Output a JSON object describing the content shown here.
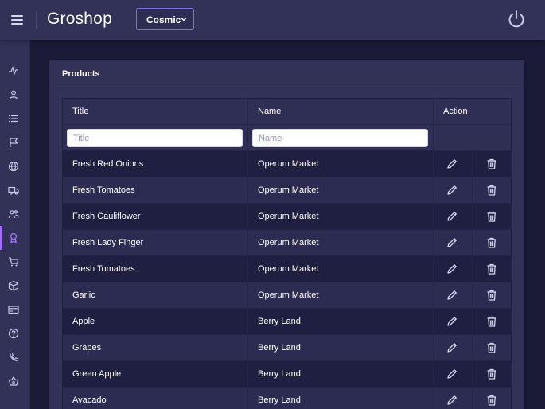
{
  "header": {
    "brand": "Groshop",
    "theme": "Cosmic",
    "menu_icon": "hamburger-icon",
    "power_icon": "power-icon"
  },
  "sidebar": {
    "items": [
      {
        "icon": "activity-icon"
      },
      {
        "icon": "user-icon"
      },
      {
        "icon": "list-icon"
      },
      {
        "icon": "flag-icon"
      },
      {
        "icon": "globe-icon"
      },
      {
        "icon": "truck-icon"
      },
      {
        "icon": "people-icon"
      },
      {
        "icon": "award-icon",
        "active": true
      },
      {
        "icon": "cart-icon"
      },
      {
        "icon": "cube-icon"
      },
      {
        "icon": "credit-card-icon"
      },
      {
        "icon": "question-icon"
      },
      {
        "icon": "phone-icon"
      },
      {
        "icon": "basket-icon"
      }
    ]
  },
  "products": {
    "card_title": "Products",
    "columns": {
      "title": "Title",
      "name": "Name",
      "action": "Action"
    },
    "filters": {
      "title_placeholder": "Title",
      "name_placeholder": "Name"
    },
    "rows": [
      {
        "title": "Fresh Red Onions",
        "name": "Operum Market"
      },
      {
        "title": "Fresh Tomatoes",
        "name": "Operum Market"
      },
      {
        "title": "Fresh Cauliflower",
        "name": "Operum Market"
      },
      {
        "title": "Fresh Lady Finger",
        "name": "Operum Market"
      },
      {
        "title": "Fresh Tomatoes",
        "name": "Operum Market"
      },
      {
        "title": "Garlic",
        "name": "Operum Market"
      },
      {
        "title": "Apple",
        "name": "Berry Land"
      },
      {
        "title": "Grapes",
        "name": "Berry Land"
      },
      {
        "title": "Green Apple",
        "name": "Berry Land"
      },
      {
        "title": "Avacado",
        "name": "Berry Land"
      }
    ]
  },
  "colors": {
    "header_bg": "#323259",
    "page_bg": "#1b1b38",
    "accent": "#a16eff",
    "select_border": "#7a6fe0"
  }
}
